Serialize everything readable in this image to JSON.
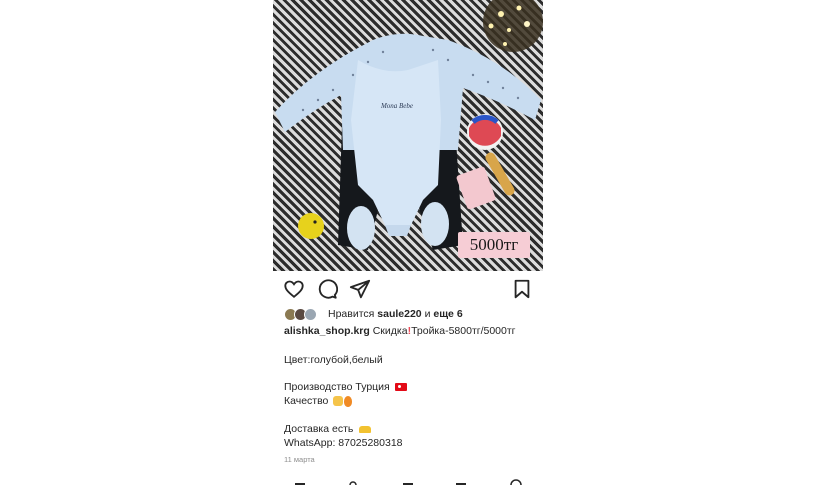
{
  "post": {
    "price_tag": "5000тг",
    "likes": {
      "prefix": "Нравится",
      "user": "saule220",
      "conjunction": "и",
      "others": "еще 6"
    },
    "caption": {
      "username": "alishka_shop.krg",
      "first_line_a": "Скидка",
      "first_line_b": "Тройка-5800тг/5000тг",
      "color_line": "Цвет:голубой,белый",
      "origin_line": "Производство Турция",
      "quality_line": "Качество",
      "delivery_line": "Доставка есть",
      "whatsapp_line": "WhatsApp: 87025280318"
    },
    "date": "11 марта"
  },
  "icons": {
    "like": "heart-icon",
    "comment": "comment-icon",
    "share": "send-icon",
    "save": "bookmark-icon"
  },
  "colors": {
    "accent_text": "#262626",
    "muted_text": "#8e8e8e",
    "price_tag_bg": "#f6cdd5",
    "exclamation": "#ed4956"
  }
}
